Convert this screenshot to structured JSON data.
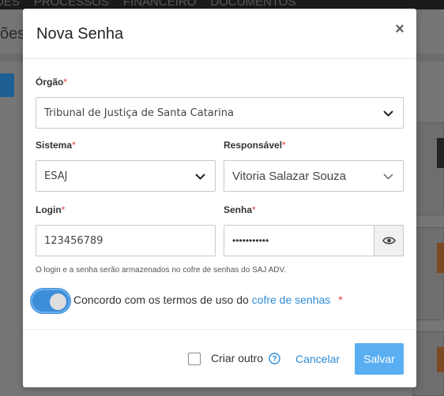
{
  "background": {
    "nav_items": [
      "DES",
      "PROCESSOS",
      "FINANCEIRO",
      "DOCUMENTOS"
    ],
    "page_title_fragment": "ões"
  },
  "modal": {
    "title": "Nova Senha",
    "close_glyph": "×",
    "orgao": {
      "label": "Órgão",
      "required_mark": "*",
      "value": "Tribunal de Justiça de Santa Catarina"
    },
    "sistema": {
      "label": "Sistema",
      "required_mark": "*",
      "value": "ESAJ"
    },
    "responsavel": {
      "label": "Responsável",
      "required_mark": "*",
      "value": "Vitoria Salazar Souza"
    },
    "login": {
      "label": "Login",
      "required_mark": "*",
      "value": "123456789"
    },
    "senha": {
      "label": "Senha",
      "required_mark": "*",
      "value": "•••••••••••"
    },
    "help_text": "O login e a senha serão armazenados no cofre de senhas do SAJ ADV.",
    "terms": {
      "text": "Concordo com os termos de uso do ",
      "link": "cofre de senhas",
      "required_mark": "*",
      "toggle_on": true
    },
    "footer": {
      "criar_outro_label": "Criar outro",
      "criar_outro_checked": false,
      "cancel_label": "Cancelar",
      "save_label": "Salvar"
    }
  },
  "colors": {
    "accent": "#2f8bd4",
    "save_button": "#5aaef2",
    "toggle": "#3d8ed9",
    "required": "#e4393c"
  }
}
